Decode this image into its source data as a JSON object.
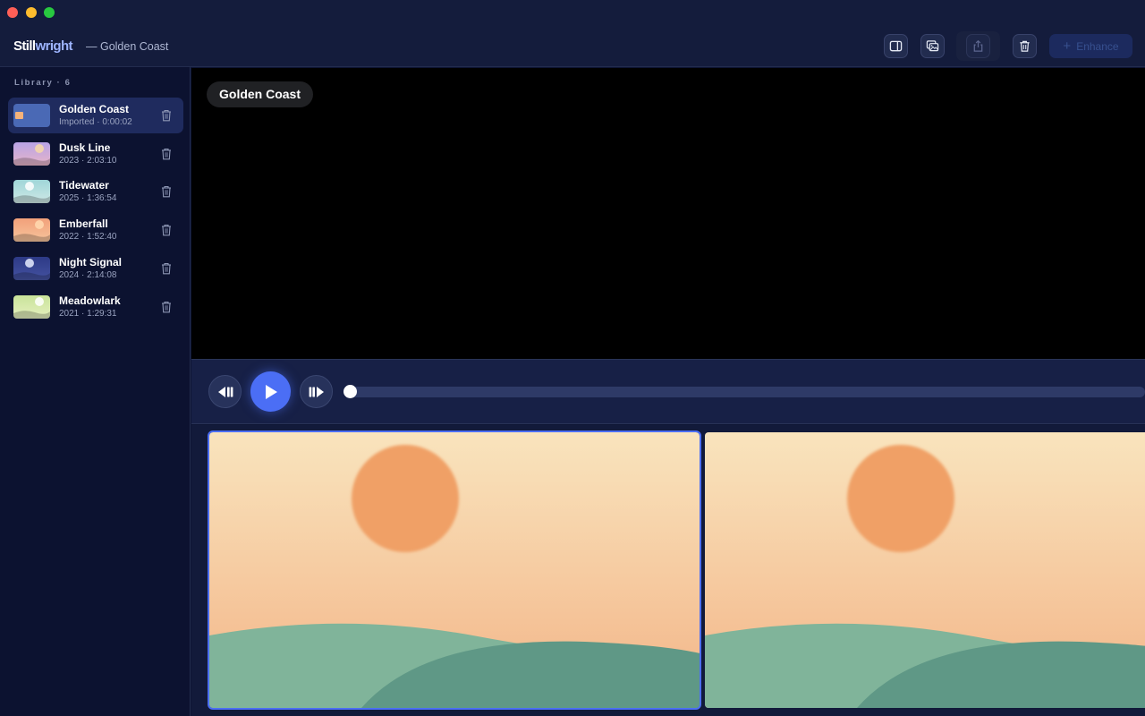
{
  "window": {
    "brand_part1": "Still",
    "brand_part2": "wright",
    "doc_title": "— Golden Coast"
  },
  "toolbar": {
    "buttons": [
      {
        "name": "toggle-panel",
        "icon": "sidebar-right-icon"
      },
      {
        "name": "gallery",
        "icon": "images-icon"
      },
      {
        "name": "share",
        "icon": "share-icon",
        "disabled": true
      },
      {
        "name": "delete",
        "icon": "trash-icon"
      }
    ],
    "enhance_label": "Enhance",
    "enhance_icon": "plus-icon"
  },
  "library": {
    "heading": "Library · 6",
    "items": [
      {
        "title": "Golden Coast",
        "meta": "Imported · 0:00:02",
        "active": true,
        "thumb_colors": [
          "#4a69b5",
          "#5a78c2"
        ],
        "sun_color": "#f5b27a"
      },
      {
        "title": "Dusk Line",
        "meta": "2023 · 2:03:10",
        "active": false,
        "thumb_colors": [
          "#b8a3e6",
          "#e7b5c8"
        ],
        "sun_color": "#f7d9a8"
      },
      {
        "title": "Tidewater",
        "meta": "2025 · 1:36:54",
        "active": false,
        "thumb_colors": [
          "#9fd6d8",
          "#cfe8e6"
        ],
        "sun_color": "#ffffff"
      },
      {
        "title": "Emberfall",
        "meta": "2022 · 1:52:40",
        "active": false,
        "thumb_colors": [
          "#f2a07a",
          "#f6c49c"
        ],
        "sun_color": "#ffd9b0"
      },
      {
        "title": "Night Signal",
        "meta": "2024 · 2:14:08",
        "active": false,
        "thumb_colors": [
          "#2d3a86",
          "#4452a0"
        ],
        "sun_color": "#e6ecff"
      },
      {
        "title": "Meadowlark",
        "meta": "2021 · 1:29:31",
        "active": false,
        "thumb_colors": [
          "#c9e39a",
          "#e5f0bf"
        ],
        "sun_color": "#ffffff"
      }
    ]
  },
  "preview": {
    "title_pill": "Golden Coast"
  },
  "player": {
    "progress": 0.0,
    "buttons": [
      "step-back-icon",
      "play-icon",
      "step-forward-icon"
    ]
  },
  "filmstrip": {
    "frames": [
      {
        "selected": true
      },
      {
        "selected": false
      }
    ],
    "colors": {
      "sky_top": "#f9e4bd",
      "sky_bottom": "#f3b487",
      "sun": "#f0a066",
      "hill_front": "#80b49a",
      "hill_back": "#5f9886"
    }
  },
  "accent": "#4b6ef5"
}
